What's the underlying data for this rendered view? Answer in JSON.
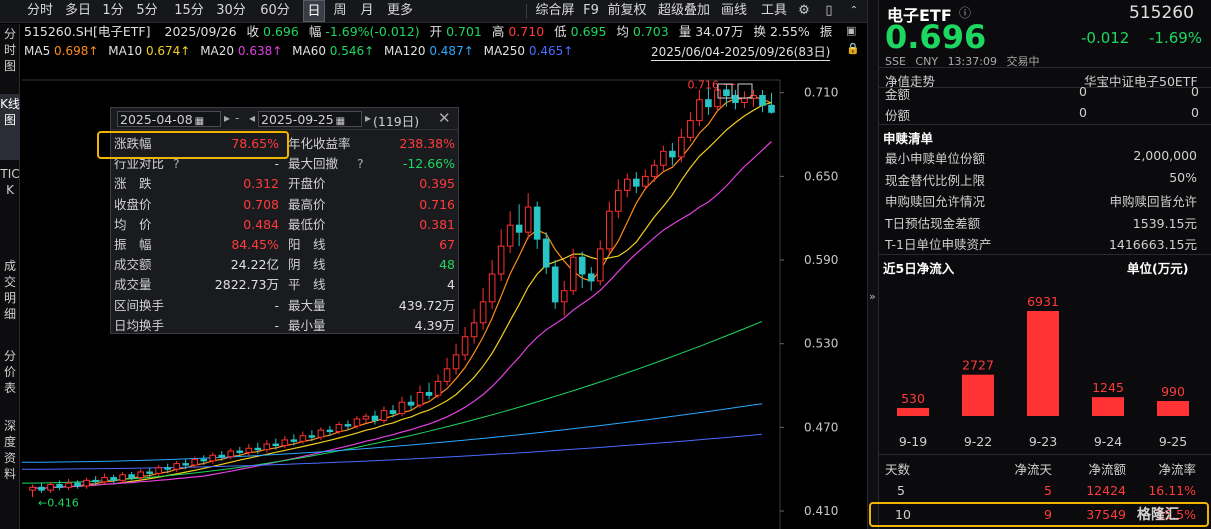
{
  "toolbar": {
    "periods": [
      "分时",
      "多日",
      "1分",
      "5分",
      "15分",
      "30分",
      "60分",
      "日",
      "周",
      "月",
      "更多"
    ],
    "active_period": "日",
    "tools": [
      "综合屏",
      "F9",
      "前复权",
      "超级叠加",
      "画线",
      "工具"
    ]
  },
  "vtabs": [
    "分时图",
    "K线图",
    "TICK",
    "成交明细",
    "分价表",
    "深度资料"
  ],
  "quote_line": {
    "code": "515260.SH[电子ETF]",
    "date": "2025/09/26",
    "close_label": "收",
    "close": "0.696",
    "amp_label": "幅",
    "change": "-1.69%(-0.012)",
    "open_label": "开",
    "open": "0.701",
    "high_label": "高",
    "high": "0.710",
    "low_label": "低",
    "low": "0.695",
    "avg_label": "均",
    "avg": "0.703",
    "vol_label": "量",
    "volume": "34.07万",
    "turnover_label": "换",
    "turnover": "2.55%",
    "zhen_label": "振"
  },
  "ma_line": {
    "items": [
      {
        "label": "MA5",
        "value": "0.698↑",
        "color": "#ff8c1a"
      },
      {
        "label": "MA10",
        "value": "0.674↑",
        "color": "#f0d020"
      },
      {
        "label": "MA20",
        "value": "0.638↑",
        "color": "#e040e0"
      },
      {
        "label": "MA60",
        "value": "0.546↑",
        "color": "#1ed760"
      },
      {
        "label": "MA120",
        "value": "0.487↑",
        "color": "#2aa8ff"
      },
      {
        "label": "MA250",
        "value": "0.465↑",
        "color": "#4a6cff"
      }
    ],
    "range": "2025/06/04-2025/09/26(83日)"
  },
  "chart_data": {
    "type": "candlestick",
    "y_ticks": [
      "0.710",
      "0.650",
      "0.590",
      "0.530",
      "0.470",
      "0.410"
    ],
    "ylim": [
      0.405,
      0.722
    ],
    "high_label": "0.716",
    "low_label": "0.416",
    "candles": [
      [
        0.425,
        0.427,
        0.42,
        0.429
      ],
      [
        0.427,
        0.425,
        0.423,
        0.43
      ],
      [
        0.425,
        0.429,
        0.423,
        0.431
      ],
      [
        0.429,
        0.427,
        0.425,
        0.432
      ],
      [
        0.427,
        0.43,
        0.425,
        0.433
      ],
      [
        0.43,
        0.428,
        0.426,
        0.432
      ],
      [
        0.428,
        0.432,
        0.426,
        0.434
      ],
      [
        0.432,
        0.431,
        0.429,
        0.435
      ],
      [
        0.431,
        0.434,
        0.429,
        0.437
      ],
      [
        0.434,
        0.432,
        0.43,
        0.436
      ],
      [
        0.432,
        0.436,
        0.43,
        0.438
      ],
      [
        0.436,
        0.434,
        0.432,
        0.438
      ],
      [
        0.434,
        0.438,
        0.432,
        0.44
      ],
      [
        0.438,
        0.437,
        0.434,
        0.441
      ],
      [
        0.437,
        0.441,
        0.435,
        0.443
      ],
      [
        0.441,
        0.44,
        0.437,
        0.444
      ],
      [
        0.44,
        0.444,
        0.438,
        0.446
      ],
      [
        0.444,
        0.443,
        0.44,
        0.447
      ],
      [
        0.443,
        0.447,
        0.441,
        0.449
      ],
      [
        0.447,
        0.446,
        0.443,
        0.45
      ],
      [
        0.446,
        0.45,
        0.444,
        0.452
      ],
      [
        0.45,
        0.449,
        0.446,
        0.453
      ],
      [
        0.449,
        0.453,
        0.447,
        0.455
      ],
      [
        0.453,
        0.452,
        0.449,
        0.456
      ],
      [
        0.452,
        0.455,
        0.45,
        0.458
      ],
      [
        0.455,
        0.454,
        0.451,
        0.459
      ],
      [
        0.454,
        0.458,
        0.452,
        0.461
      ],
      [
        0.458,
        0.457,
        0.454,
        0.462
      ],
      [
        0.457,
        0.461,
        0.455,
        0.464
      ],
      [
        0.461,
        0.46,
        0.457,
        0.465
      ],
      [
        0.46,
        0.464,
        0.458,
        0.467
      ],
      [
        0.464,
        0.463,
        0.46,
        0.468
      ],
      [
        0.463,
        0.468,
        0.461,
        0.47
      ],
      [
        0.468,
        0.467,
        0.464,
        0.471
      ],
      [
        0.467,
        0.472,
        0.465,
        0.474
      ],
      [
        0.472,
        0.471,
        0.468,
        0.475
      ],
      [
        0.471,
        0.476,
        0.469,
        0.478
      ],
      [
        0.476,
        0.478,
        0.473,
        0.48
      ],
      [
        0.478,
        0.475,
        0.472,
        0.482
      ],
      [
        0.475,
        0.482,
        0.473,
        0.485
      ],
      [
        0.482,
        0.48,
        0.477,
        0.486
      ],
      [
        0.48,
        0.488,
        0.478,
        0.492
      ],
      [
        0.488,
        0.486,
        0.483,
        0.493
      ],
      [
        0.486,
        0.495,
        0.484,
        0.5
      ],
      [
        0.495,
        0.493,
        0.49,
        0.502
      ],
      [
        0.493,
        0.503,
        0.491,
        0.508
      ],
      [
        0.503,
        0.512,
        0.5,
        0.52
      ],
      [
        0.512,
        0.522,
        0.508,
        0.53
      ],
      [
        0.522,
        0.535,
        0.518,
        0.542
      ],
      [
        0.535,
        0.545,
        0.53,
        0.555
      ],
      [
        0.545,
        0.56,
        0.54,
        0.57
      ],
      [
        0.56,
        0.58,
        0.555,
        0.59
      ],
      [
        0.58,
        0.6,
        0.575,
        0.612
      ],
      [
        0.6,
        0.615,
        0.595,
        0.625
      ],
      [
        0.615,
        0.61,
        0.6,
        0.63
      ],
      [
        0.61,
        0.628,
        0.605,
        0.638
      ],
      [
        0.628,
        0.605,
        0.598,
        0.632
      ],
      [
        0.605,
        0.585,
        0.58,
        0.61
      ],
      [
        0.585,
        0.56,
        0.555,
        0.59
      ],
      [
        0.56,
        0.568,
        0.55,
        0.575
      ],
      [
        0.568,
        0.592,
        0.565,
        0.598
      ],
      [
        0.592,
        0.58,
        0.57,
        0.596
      ],
      [
        0.58,
        0.575,
        0.568,
        0.585
      ],
      [
        0.575,
        0.598,
        0.572,
        0.604
      ],
      [
        0.598,
        0.625,
        0.595,
        0.632
      ],
      [
        0.625,
        0.64,
        0.62,
        0.648
      ],
      [
        0.64,
        0.648,
        0.635,
        0.652
      ],
      [
        0.648,
        0.643,
        0.638,
        0.653
      ],
      [
        0.643,
        0.65,
        0.64,
        0.655
      ],
      [
        0.65,
        0.658,
        0.646,
        0.662
      ],
      [
        0.658,
        0.668,
        0.654,
        0.672
      ],
      [
        0.668,
        0.664,
        0.658,
        0.674
      ],
      [
        0.664,
        0.678,
        0.66,
        0.684
      ],
      [
        0.678,
        0.69,
        0.675,
        0.696
      ],
      [
        0.69,
        0.705,
        0.686,
        0.712
      ],
      [
        0.705,
        0.7,
        0.694,
        0.714
      ],
      [
        0.7,
        0.712,
        0.697,
        0.716
      ],
      [
        0.712,
        0.708,
        0.7,
        0.716
      ],
      [
        0.708,
        0.703,
        0.698,
        0.712
      ],
      [
        0.703,
        0.706,
        0.699,
        0.711
      ],
      [
        0.706,
        0.708,
        0.7,
        0.712
      ],
      [
        0.708,
        0.701,
        0.696,
        0.712
      ],
      [
        0.701,
        0.696,
        0.695,
        0.71
      ]
    ]
  },
  "popup": {
    "date_from": "2025-04-08",
    "date_to": "2025-09-25",
    "days": "(119日)",
    "left": [
      {
        "label": "涨跌幅",
        "value": "78.65%",
        "color": "#ff3b3b"
      },
      {
        "label": "行业对比",
        "value": "-",
        "color": "#d0d0d0",
        "help": true
      },
      {
        "label": "涨　跌",
        "value": "0.312",
        "color": "#ff3b3b"
      },
      {
        "label": "收盘价",
        "value": "0.708",
        "color": "#ff3b3b"
      },
      {
        "label": "均　价",
        "value": "0.484",
        "color": "#ff3b3b"
      },
      {
        "label": "振　幅",
        "value": "84.45%",
        "color": "#ff3b3b"
      },
      {
        "label": "成交额",
        "value": "24.22亿",
        "color": "#e0e0e0"
      },
      {
        "label": "成交量",
        "value": "2822.73万",
        "color": "#e0e0e0"
      },
      {
        "label": "区间换手",
        "value": "-",
        "color": "#d0d0d0"
      },
      {
        "label": "日均换手",
        "value": "-",
        "color": "#d0d0d0"
      }
    ],
    "right": [
      {
        "label": "年化收益率",
        "value": "238.38%",
        "color": "#ff3b3b"
      },
      {
        "label": "最大回撤",
        "value": "-12.66%",
        "color": "#1ed760",
        "help": true
      },
      {
        "label": "开盘价",
        "value": "0.395",
        "color": "#ff3b3b"
      },
      {
        "label": "最高价",
        "value": "0.716",
        "color": "#ff3b3b"
      },
      {
        "label": "最低价",
        "value": "0.381",
        "color": "#ff3b3b"
      },
      {
        "label": "阳　线",
        "value": "67",
        "color": "#ff3b3b"
      },
      {
        "label": "阴　线",
        "value": "48",
        "color": "#1ed760"
      },
      {
        "label": "平　线",
        "value": "4",
        "color": "#e0e0e0"
      },
      {
        "label": "最大量",
        "value": "439.72万",
        "color": "#e0e0e0"
      },
      {
        "label": "最小量",
        "value": "4.39万",
        "color": "#e0e0e0"
      }
    ]
  },
  "rpanel": {
    "name": "电子ETF",
    "code": "515260",
    "price": "0.696",
    "change": "-0.012",
    "change_pct": "-1.69%",
    "exchange": "SSE",
    "currency": "CNY",
    "time": "13:37:09",
    "status": "交易中",
    "nav_label": "净值走势",
    "tracking": "华宝中证电子50ETF",
    "partial_rows": [
      {
        "label": "金额",
        "v1": "0",
        "v2": "0"
      },
      {
        "label": "份额",
        "v1": "0",
        "v2": "0"
      }
    ],
    "subscribe_title": "申赎清单",
    "subscribe_rows": [
      {
        "label": "最小申赎单位份额",
        "value": "2,000,000"
      },
      {
        "label": "现金替代比例上限",
        "value": "50%"
      },
      {
        "label": "申购赎回允许情况",
        "value": "申购赎回皆允许"
      },
      {
        "label": "T日预估现金差额",
        "value": "1539.15元"
      },
      {
        "label": "T-1日单位申赎资产",
        "value": "1416663.15元"
      }
    ],
    "flow_title": "近5日净流入",
    "flow_unit": "单位(万元)",
    "flow_chart": {
      "type": "bar",
      "categories": [
        "9-19",
        "9-22",
        "9-23",
        "9-24",
        "9-25"
      ],
      "values": [
        530,
        2727,
        6931,
        1245,
        990
      ]
    },
    "table_headers": [
      "天数",
      "净流天",
      "净流额",
      "净流率"
    ],
    "table_rows": [
      {
        "days": "5",
        "flow_days": "5",
        "amount": "12424",
        "rate": "16.11%"
      },
      {
        "days": "10",
        "flow_days": "9",
        "amount": "37549",
        "rate": "15.5%"
      }
    ],
    "watermark": "格隆汇"
  }
}
